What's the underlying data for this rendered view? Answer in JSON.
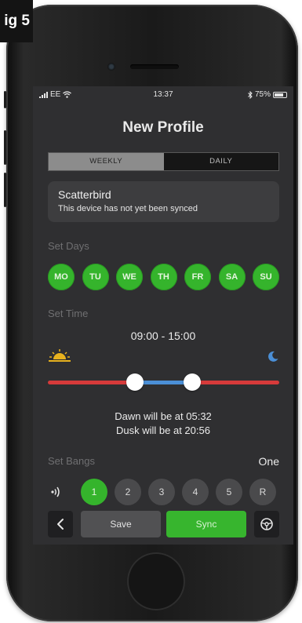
{
  "figure_label": "ig 5",
  "status_bar": {
    "carrier": "EE",
    "time": "13:37",
    "battery_percent": "75%",
    "battery_level": 0.75
  },
  "title": "New Profile",
  "tabs": [
    {
      "label": "WEEKLY",
      "active": true
    },
    {
      "label": "DAILY",
      "active": false
    }
  ],
  "device": {
    "name": "Scatterbird",
    "status": "This device has not yet been synced"
  },
  "set_days": {
    "label": "Set Days",
    "days": [
      "MO",
      "TU",
      "WE",
      "TH",
      "FR",
      "SA",
      "SU"
    ]
  },
  "set_time": {
    "label": "Set Time",
    "range": "09:00 - 15:00",
    "slider_start_hour": 9,
    "slider_end_hour": 15,
    "dawn_text": "Dawn will be at 05:32",
    "dusk_text": "Dusk will be at 20:56"
  },
  "set_bangs": {
    "label": "Set Bangs",
    "value": "One",
    "options": [
      "1",
      "2",
      "3",
      "4",
      "5",
      "R"
    ],
    "selected": "1"
  },
  "actions": {
    "save_label": "Save",
    "sync_label": "Sync"
  },
  "colors": {
    "accent_green": "#35b42c",
    "slider_red": "#d63a3a",
    "slider_blue": "#4b8fd6",
    "screen_bg": "#2f2f31"
  },
  "icons": {
    "signal": "signal-bars-icon",
    "wifi": "wifi-icon",
    "bluetooth": "bluetooth-icon",
    "battery": "battery-icon",
    "sunrise": "sunrise-icon",
    "moon": "moon-icon",
    "sound": "sound-wave-icon",
    "back": "chevron-left-icon",
    "settings": "steering-wheel-icon"
  }
}
